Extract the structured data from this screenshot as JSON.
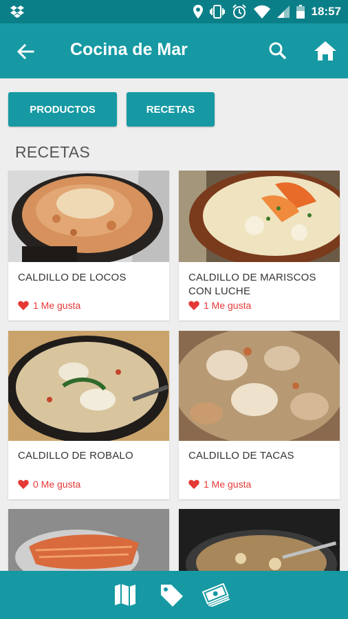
{
  "status_bar": {
    "time": "18:57",
    "icons": [
      "dropbox-icon",
      "location-icon",
      "vibrate-icon",
      "alarm-icon",
      "wifi-icon",
      "signal-icon",
      "battery-icon"
    ]
  },
  "app_bar": {
    "title": "Cocina de Mar",
    "icons": [
      "back-arrow-icon",
      "search-icon",
      "home-icon"
    ]
  },
  "tabs": {
    "productos_label": "PRODUCTOS",
    "recetas_label": "RECETAS"
  },
  "section": {
    "title": "RECETAS"
  },
  "recipes": [
    {
      "name": "CALDILLO DE LOCOS",
      "likes": "1 Me gusta"
    },
    {
      "name": "CALDILLO DE MARISCOS CON LUCHE",
      "likes": "1 Me gusta"
    },
    {
      "name": "CALDILLO DE ROBALO",
      "likes": "0 Me gusta"
    },
    {
      "name": "CALDILLO DE TACAS",
      "likes": "1 Me gusta"
    }
  ],
  "bottom_nav": {
    "icons": [
      "map-icon",
      "tag-icon",
      "money-icon"
    ]
  },
  "colors": {
    "status_bar": "#0b7f88",
    "primary": "#1699a3",
    "like": "#e53935",
    "background": "#eeeeee"
  }
}
